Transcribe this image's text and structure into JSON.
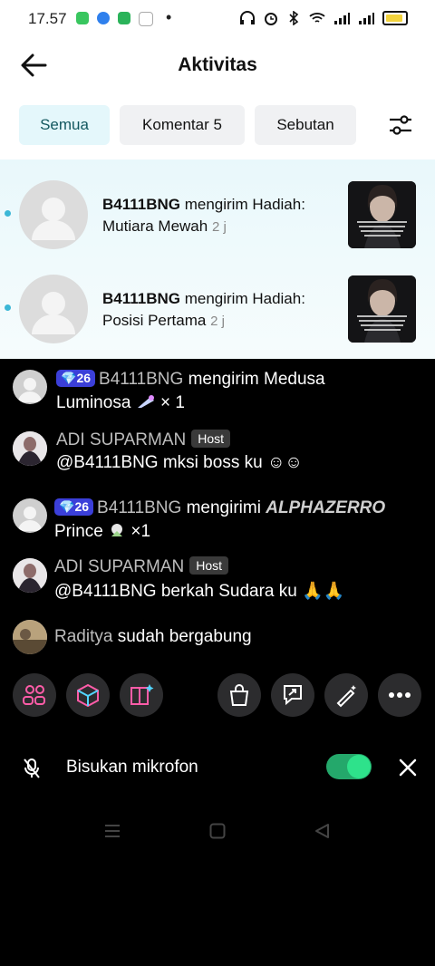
{
  "status_bar": {
    "time": "17.57",
    "dot": "•"
  },
  "header": {
    "title": "Aktivitas"
  },
  "tabs": [
    {
      "label": "Semua"
    },
    {
      "label": "Komentar 5"
    },
    {
      "label": "Sebutan"
    }
  ],
  "notifications": [
    {
      "user": "B4111BNG",
      "action": " mengirim Hadiah:",
      "gift": "Mutiara Mewah",
      "time": "2 j"
    },
    {
      "user": "B4111BNG",
      "action": " mengirim Hadiah:",
      "gift": "Posisi Pertama",
      "time": "2 j"
    }
  ],
  "chat": {
    "messages": [
      {
        "level": "26",
        "user": "B4111BNG",
        "line1": " mengirim Medusa",
        "line2": "Luminosa",
        "suffix": " × 1"
      },
      {
        "user": "ADI SUPARMAN",
        "badge": "Host",
        "text": "@B4111BNG mksi boss ku ☺☺"
      },
      {
        "level": "26",
        "user": "B4111BNG",
        "line1": " mengirimi ",
        "gift": "ALPHAZERRO",
        "line2": "Prince",
        "suffix": " ×1"
      },
      {
        "user": "ADI SUPARMAN",
        "badge": "Host",
        "text": "@B4111BNG berkah Sudara ku 🙏🙏"
      },
      {
        "user": "Raditya",
        "text": " sudah bergabung"
      }
    ]
  },
  "mic": {
    "label": "Bisukan mikrofon",
    "enabled": true
  },
  "colors": {
    "accent": "#2ee28b",
    "level_badge": "#3b3fd9",
    "unread_dot": "#3bb7d6"
  }
}
